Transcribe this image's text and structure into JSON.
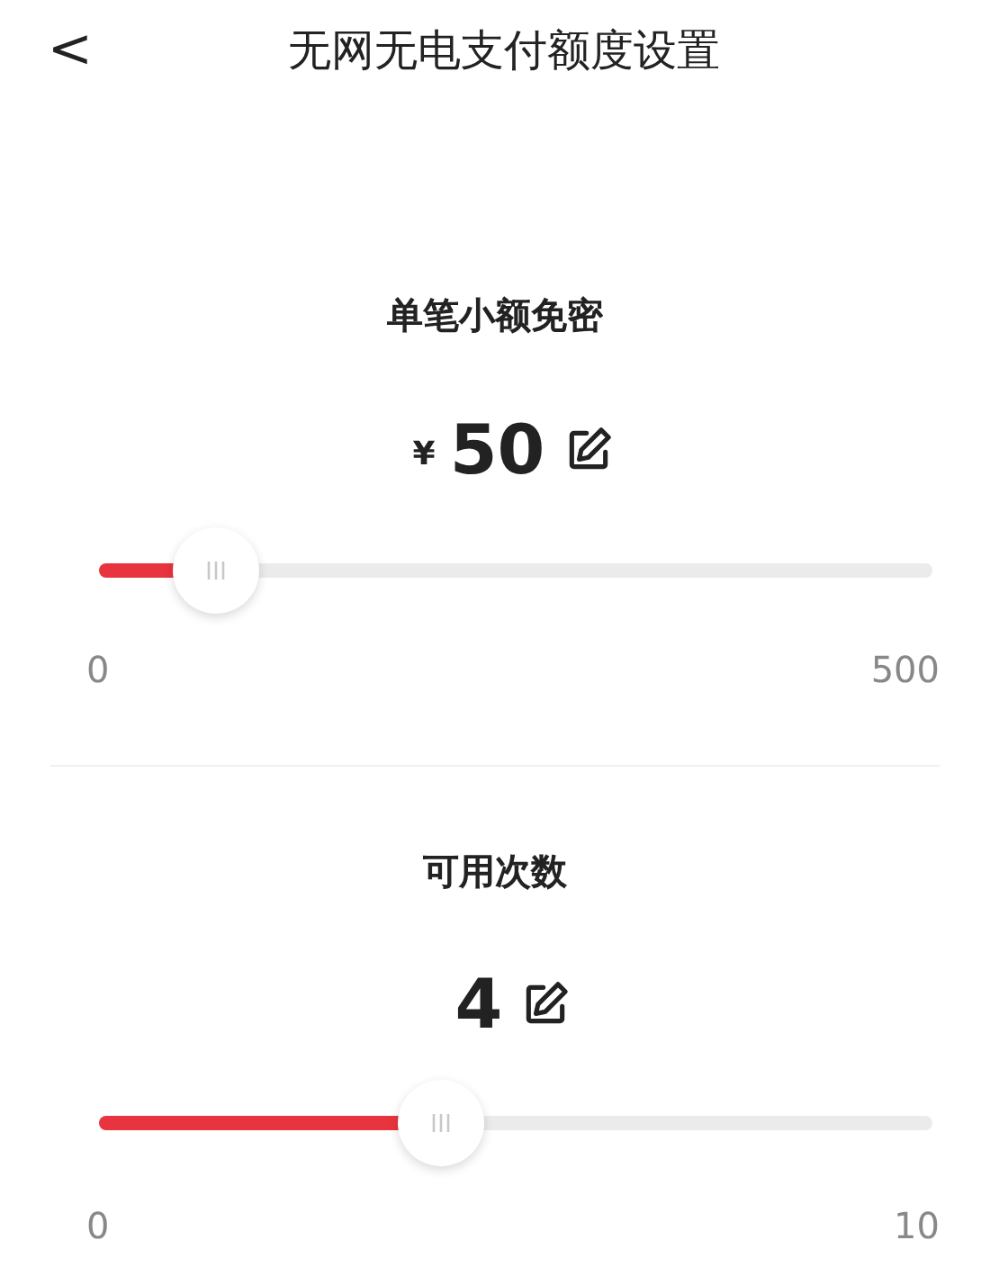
{
  "header": {
    "back": "<",
    "title": "无网无电支付额度设置"
  },
  "settings": [
    {
      "title": "单笔小额免密",
      "currency": "¥",
      "value": "50",
      "level": 0.14,
      "min": "0",
      "max": "500"
    },
    {
      "title": "可用次数",
      "value": "4",
      "level": 0.41,
      "min": "0",
      "max": "10"
    }
  ]
}
